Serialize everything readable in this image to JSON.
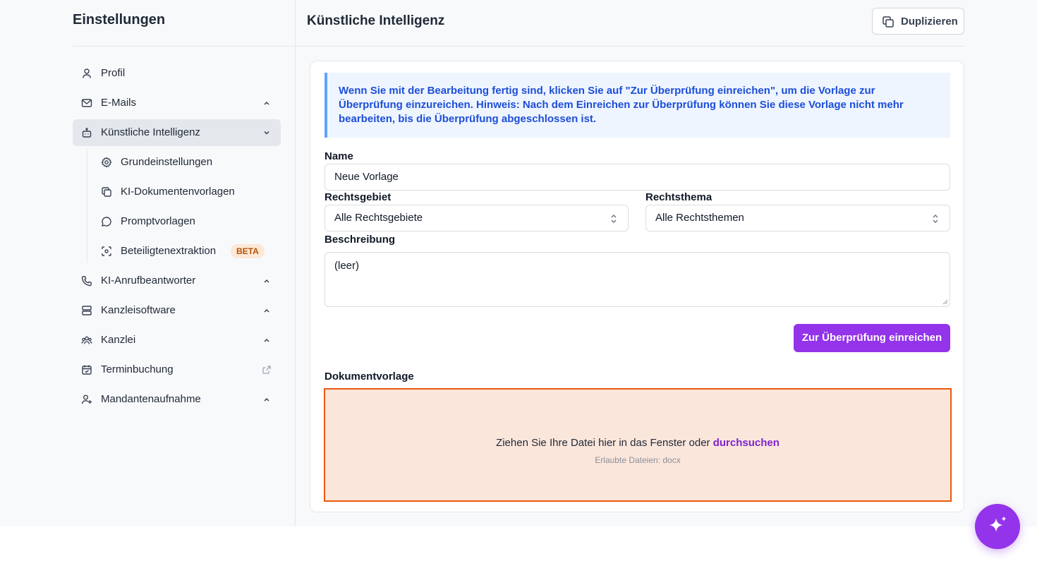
{
  "sidebar": {
    "title": "Einstellungen",
    "items": [
      {
        "label": "Profil",
        "icon": "user-icon"
      },
      {
        "label": "E-Mails",
        "icon": "mail-icon"
      },
      {
        "label": "Künstliche Intelligenz",
        "icon": "bot-icon",
        "active": true
      },
      {
        "label": "KI-Anrufbeantworter",
        "icon": "phone-icon"
      },
      {
        "label": "Kanzleisoftware",
        "icon": "server-icon"
      },
      {
        "label": "Kanzlei",
        "icon": "users-icon"
      },
      {
        "label": "Terminbuchung",
        "icon": "calendar-icon"
      },
      {
        "label": "Mandantenaufnahme",
        "icon": "user-plus-icon"
      }
    ],
    "subitems": [
      {
        "label": "Grundeinstellungen",
        "icon": "gear-icon"
      },
      {
        "label": "KI-Dokumentenvorlagen",
        "icon": "copy-icon"
      },
      {
        "label": "Promptvorlagen",
        "icon": "chat-icon"
      },
      {
        "label": "Beteiligtenextraktion",
        "icon": "scan-icon",
        "badge": "BETA"
      }
    ]
  },
  "header": {
    "title": "Künstliche Intelligenz",
    "duplicate_label": "Duplizieren"
  },
  "notice": {
    "text_before": "Wenn Sie mit der Bearbeitung fertig sind, klicken Sie auf \"Zur Überprüfung einreichen\", um die Vorlage zur Überprüfung einzureichen.",
    "bold": "Hinweis:",
    "text_after": "Nach dem Einreichen zur Überprüfung können Sie diese Vorlage nicht mehr bearbeiten, bis die Überprüfung abgeschlossen ist."
  },
  "form": {
    "name_label": "Name",
    "name_value": "Neue Vorlage",
    "rechtsgebiet_label": "Rechtsgebiet",
    "rechtsgebiet_value": "Alle Rechtsgebiete",
    "rechtsthema_label": "Rechtsthema",
    "rechtsthema_value": "Alle Rechtsthemen",
    "beschreibung_label": "Beschreibung",
    "beschreibung_value": "(leer)",
    "submit_label": "Zur Überprüfung einreichen"
  },
  "upload": {
    "label": "Dokumentvorlage",
    "text": "Ziehen Sie Ihre Datei hier in das Fenster oder",
    "link": "durchsuchen",
    "hint": "Erlaubte Dateien: docx"
  },
  "colors": {
    "accent": "#9333ea",
    "notice_text": "#1d4ed8",
    "drop_border": "#ea580c",
    "drop_bg": "#fbe6dc"
  }
}
